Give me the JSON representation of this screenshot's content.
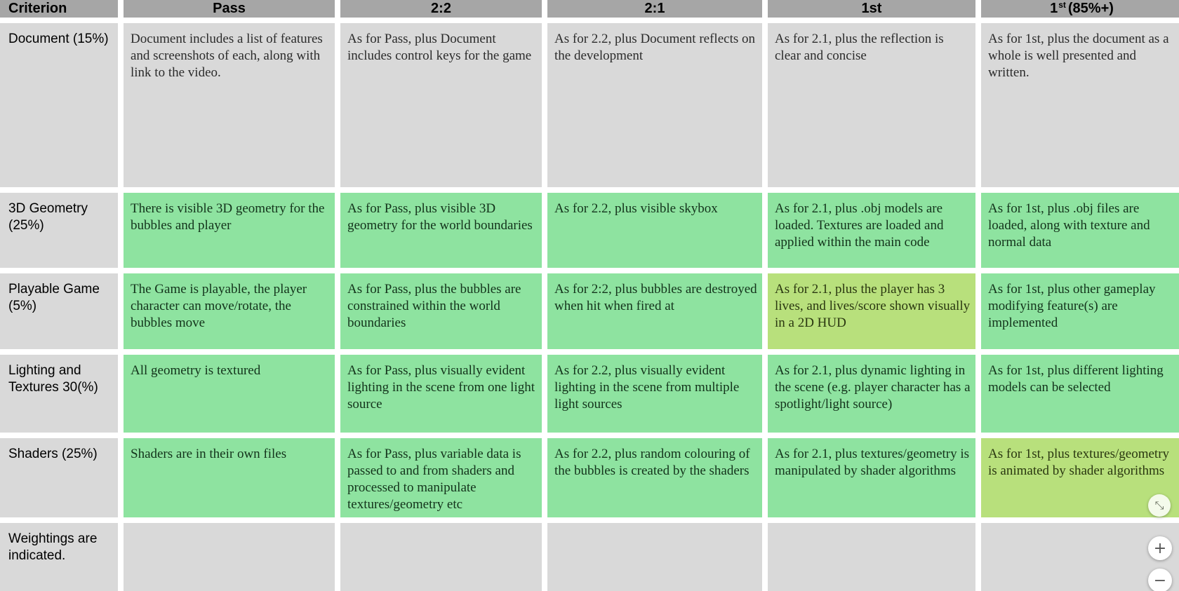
{
  "header": {
    "criterion": "Criterion",
    "pass": "Pass",
    "two_two": "2:2",
    "two_one": "2:1",
    "first": "1st",
    "first_plus_base": "1",
    "first_plus_sup": "st",
    "first_plus_rest": "(85%+)"
  },
  "rows": [
    {
      "label": "Document (15%)",
      "cells": [
        "Document includes a list of features and screenshots of each, along with link to the video.",
        "As for Pass, plus Document includes control keys for the game",
        "As for 2.2, plus Document reflects on the development",
        "As for 2.1, plus the reflection is clear and concise",
        "As for 1st, plus the document as a whole is well presented and written."
      ]
    },
    {
      "label": "3D Geometry (25%)",
      "cells": [
        "There is visible 3D geometry for the bubbles and player",
        "As for Pass, plus visible 3D geometry for the world boundaries",
        "As for 2.2, plus visible skybox",
        "As for 2.1, plus .obj models are loaded. Textures are loaded and applied within the main code",
        "As for 1st, plus .obj files are loaded, along with texture and normal data"
      ]
    },
    {
      "label": "Playable Game (5%)",
      "cells": [
        "The Game is playable, the player character can move/rotate, the bubbles move",
        "As for Pass, plus the bubbles are constrained within the world boundaries",
        "As for 2:2, plus bubbles are destroyed when hit when fired at",
        "As for 2.1, plus the player has 3 lives, and lives/score shown visually in a 2D HUD",
        "As for 1st, plus other gameplay modifying feature(s) are implemented"
      ]
    },
    {
      "label": "Lighting and Textures 30(%)",
      "cells": [
        "All geometry is textured",
        "As for Pass, plus visually evident lighting in the scene from one light source",
        "As for 2.2, plus visually evident lighting in the scene from multiple light sources",
        "As for 2.1, plus dynamic lighting in the scene (e.g. player character has a spotlight/light source)",
        "As for 1st, plus different lighting models can be selected"
      ]
    },
    {
      "label": "Shaders (25%)",
      "cells": [
        "Shaders are in their own files",
        "As for Pass, plus variable data is passed to and from shaders and processed to manipulate textures/geometry etc",
        "As for 2.2, plus random colouring of the bubbles is created by the shaders",
        "As for 2.1, plus textures/geometry is manipulated by shader algorithms",
        "As for 1st, plus textures/geometry is animated by shader algorithms"
      ]
    },
    {
      "label": "Weightings are indicated.",
      "cells": [
        "",
        "",
        "",
        "",
        ""
      ]
    }
  ],
  "colors": {
    "header_bg": "#a6a6a6",
    "cell_grey": "#d9d9d9",
    "cell_green": "#8ee3a0",
    "cell_lime": "#b8e07c"
  },
  "highlight": {
    "green": "green",
    "lime": "lime",
    "none": "none"
  },
  "zoom_controls": {
    "fit_icon": "⤡",
    "zoom_in_icon": "+",
    "zoom_out_icon": "−"
  }
}
